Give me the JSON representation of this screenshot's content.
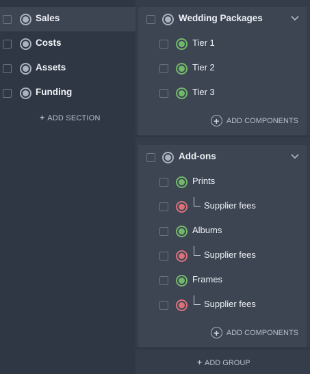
{
  "sidebar": {
    "items": [
      {
        "label": "Sales",
        "active": true
      },
      {
        "label": "Costs",
        "active": false
      },
      {
        "label": "Assets",
        "active": false
      },
      {
        "label": "Funding",
        "active": false
      }
    ],
    "add_section_label": "ADD SECTION"
  },
  "groups": [
    {
      "title": "Wedding Packages",
      "items": [
        {
          "label": "Tier 1",
          "kind": "revenue"
        },
        {
          "label": "Tier 2",
          "kind": "revenue"
        },
        {
          "label": "Tier 3",
          "kind": "revenue"
        }
      ],
      "add_components_label": "ADD COMPONENTS"
    },
    {
      "title": "Add-ons",
      "items": [
        {
          "label": "Prints",
          "kind": "revenue"
        },
        {
          "label": "Supplier fees",
          "kind": "cost"
        },
        {
          "label": "Albums",
          "kind": "revenue"
        },
        {
          "label": "Supplier fees",
          "kind": "cost"
        },
        {
          "label": "Frames",
          "kind": "revenue"
        },
        {
          "label": "Supplier fees",
          "kind": "cost"
        }
      ],
      "add_components_label": "ADD COMPONENTS"
    }
  ],
  "add_group_label": "ADD GROUP",
  "colors": {
    "revenue": "#72b86a",
    "cost": "#d9727a",
    "neutral": "#aab2be"
  }
}
